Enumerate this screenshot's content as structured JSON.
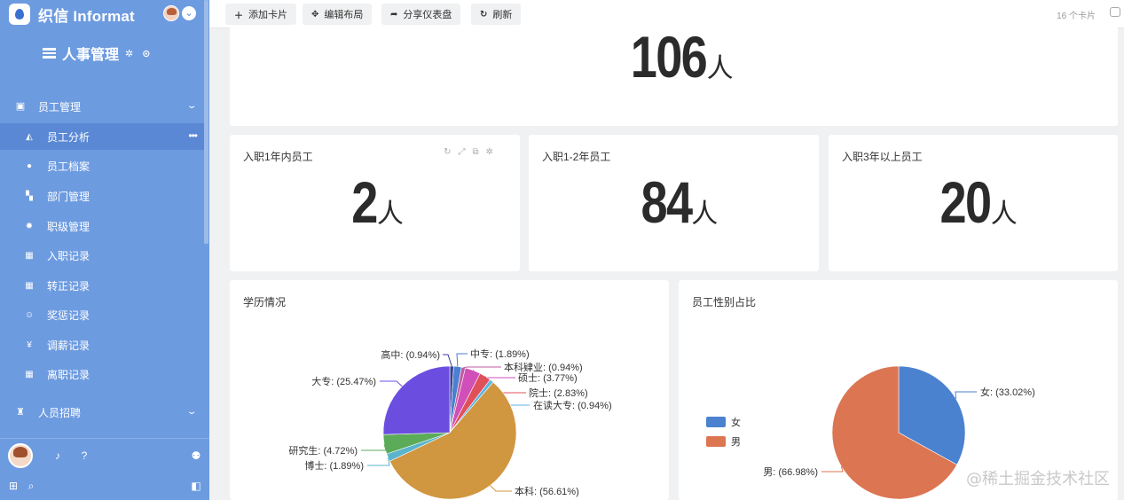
{
  "sidebar": {
    "brand": "织信 Informat",
    "app_title": "人事管理",
    "groups": [
      {
        "label": "员工管理",
        "icon": "person-badge-icon"
      },
      {
        "label": "人员招聘",
        "icon": "trophy-icon"
      }
    ],
    "items": [
      {
        "label": "员工分析",
        "icon": "area-chart-icon",
        "active": true
      },
      {
        "label": "员工档案",
        "icon": "user-circle-icon"
      },
      {
        "label": "部门管理",
        "icon": "org-tree-icon"
      },
      {
        "label": "职级管理",
        "icon": "badge-icon"
      },
      {
        "label": "入职记录",
        "icon": "table-icon"
      },
      {
        "label": "转正记录",
        "icon": "table-icon"
      },
      {
        "label": "奖惩记录",
        "icon": "smile-icon"
      },
      {
        "label": "调薪记录",
        "icon": "yen-icon"
      },
      {
        "label": "离职记录",
        "icon": "table-icon"
      }
    ]
  },
  "toolbar": {
    "add_card": "添加卡片",
    "edit_layout": "编辑布局",
    "share_dashboard": "分享仪表盘",
    "refresh": "刷新",
    "card_count": "16 个卡片"
  },
  "cards": {
    "total": {
      "value": "106",
      "unit": "人"
    },
    "within_1y": {
      "title": "入职1年内员工",
      "value": "2",
      "unit": "人"
    },
    "y1_2": {
      "title": "入职1-2年员工",
      "value": "84",
      "unit": "人"
    },
    "over_3y": {
      "title": "入职3年以上员工",
      "value": "20",
      "unit": "人"
    }
  },
  "chart_data": [
    {
      "type": "pie",
      "title": "学历情况",
      "slices": [
        {
          "label": "高中",
          "value": 0.94,
          "display": "高中: (0.94%)",
          "color": "#3b3f99"
        },
        {
          "label": "中专",
          "value": 1.89,
          "display": "中专: (1.89%)",
          "color": "#4a7fd1"
        },
        {
          "label": "本科肄业",
          "value": 0.94,
          "display": "本科肄业: (0.94%)",
          "color": "#c05a9c"
        },
        {
          "label": "硕士",
          "value": 3.77,
          "display": "硕士: (3.77%)",
          "color": "#d04fb8"
        },
        {
          "label": "院士",
          "value": 2.83,
          "display": "院士: (2.83%)",
          "color": "#e0505a"
        },
        {
          "label": "在读大专",
          "value": 0.94,
          "display": "在读大专: (0.94%)",
          "color": "#5fb6e0"
        },
        {
          "label": "本科",
          "value": 56.61,
          "display": "本科: (56.61%)",
          "color": "#d09640"
        },
        {
          "label": "博士",
          "value": 1.89,
          "display": "博士: (1.89%)",
          "color": "#5ab4cc"
        },
        {
          "label": "研究生",
          "value": 4.72,
          "display": "研究生: (4.72%)",
          "color": "#5bab58"
        },
        {
          "label": "大专",
          "value": 25.47,
          "display": "大专: (25.47%)",
          "color": "#6b4ee0"
        }
      ]
    },
    {
      "type": "pie",
      "title": "员工性别占比",
      "legend": [
        "女",
        "男"
      ],
      "slices": [
        {
          "label": "女",
          "value": 33.02,
          "display": "女: (33.02%)",
          "color": "#4b82cf"
        },
        {
          "label": "男",
          "value": 66.98,
          "display": "男: (66.98%)",
          "color": "#dc7552"
        }
      ]
    }
  ],
  "watermark": "@稀土掘金技术社区"
}
